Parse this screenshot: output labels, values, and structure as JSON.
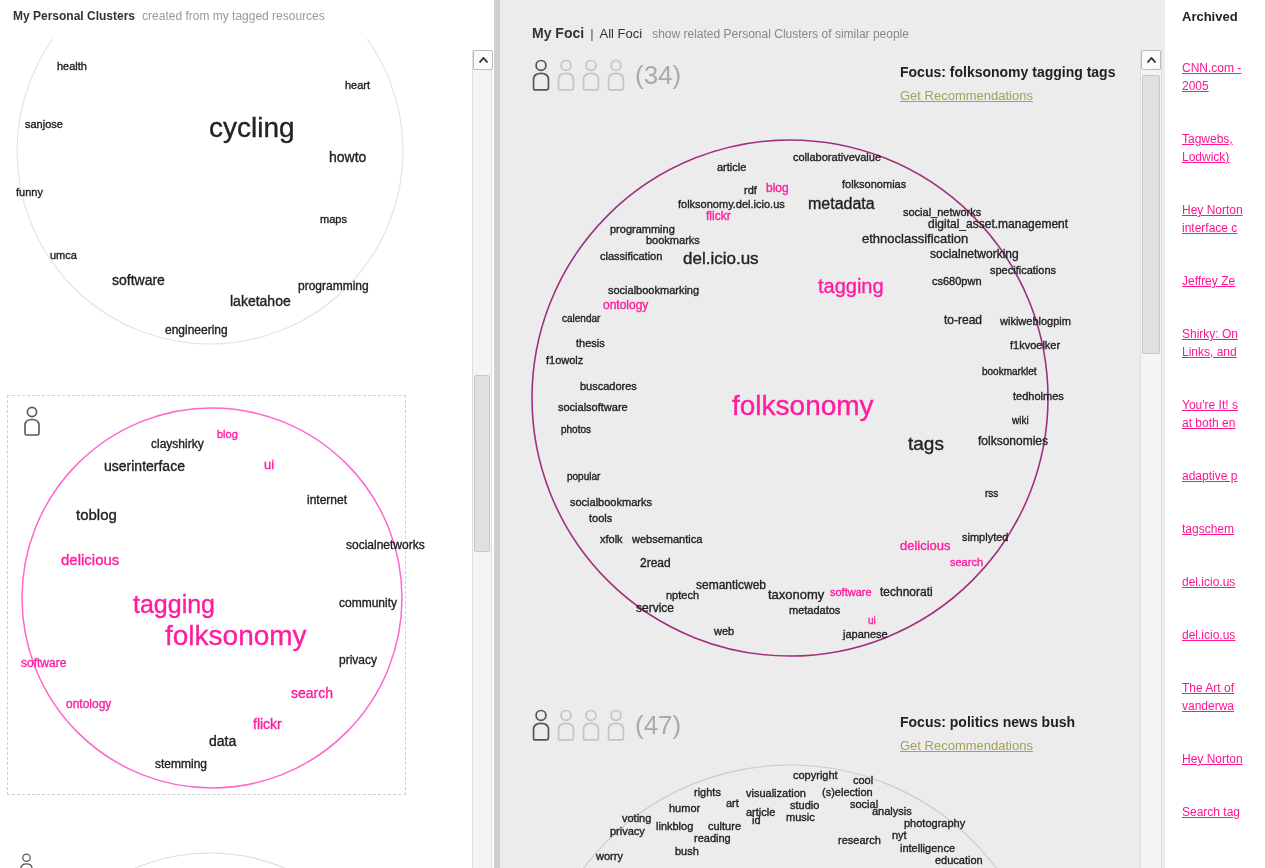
{
  "personal_clusters": {
    "title": "My Personal Clusters",
    "subtitle": "created from my tagged resources",
    "clusters": [
      {
        "color": "#e4e4e4",
        "tags": [
          {
            "text": "health",
            "color": "#222222"
          },
          {
            "text": "heart",
            "color": "#222222"
          },
          {
            "text": "sanjose",
            "color": "#222222"
          },
          {
            "text": "cycling",
            "color": "#222222"
          },
          {
            "text": "howto",
            "color": "#222222"
          },
          {
            "text": "funny",
            "color": "#222222"
          },
          {
            "text": "maps",
            "color": "#222222"
          },
          {
            "text": "umca",
            "color": "#222222"
          },
          {
            "text": "software",
            "color": "#222222"
          },
          {
            "text": "programming",
            "color": "#222222"
          },
          {
            "text": "laketahoe",
            "color": "#222222"
          },
          {
            "text": "engineering",
            "color": "#222222"
          }
        ]
      },
      {
        "color": "#ff66cc",
        "people": [
          {
            "active": true
          }
        ],
        "tags": [
          {
            "text": "clayshirky",
            "color": "#222222"
          },
          {
            "text": "blog",
            "color": "#ff1ca0"
          },
          {
            "text": "userinterface",
            "color": "#222222"
          },
          {
            "text": "ui",
            "color": "#ff1ca0"
          },
          {
            "text": "internet",
            "color": "#222222"
          },
          {
            "text": "toblog",
            "color": "#222222"
          },
          {
            "text": "socialnetworks",
            "color": "#222222"
          },
          {
            "text": "delicious",
            "color": "#ff1ca0"
          },
          {
            "text": "tagging",
            "color": "#ff1ca0"
          },
          {
            "text": "community",
            "color": "#222222"
          },
          {
            "text": "folksonomy",
            "color": "#ff1ca0"
          },
          {
            "text": "privacy",
            "color": "#222222"
          },
          {
            "text": "software",
            "color": "#ff1ca0"
          },
          {
            "text": "search",
            "color": "#ff1ca0"
          },
          {
            "text": "ontology",
            "color": "#ff1ca0"
          },
          {
            "text": "flickr",
            "color": "#ff1ca0"
          },
          {
            "text": "data",
            "color": "#222222"
          },
          {
            "text": "stemming",
            "color": "#222222"
          }
        ]
      },
      {
        "color": "#dddddd",
        "people": [
          {
            "active": true
          }
        ]
      }
    ]
  },
  "foci": {
    "title": "My Foci",
    "separator": "|",
    "all_link": "All Foci",
    "hint": "show related Personal Clusters of similar people",
    "clusters": [
      {
        "people": [
          {
            "active": true
          },
          {
            "active": false
          },
          {
            "active": false
          },
          {
            "active": false
          }
        ],
        "count": "(34)",
        "focus": "Focus: folksonomy tagging tags",
        "link": "Get Recommendations",
        "color": "#a0307f",
        "tags": [
          {
            "text": "collaborativevalue",
            "color": "#222222"
          },
          {
            "text": "article",
            "color": "#222222"
          },
          {
            "text": "rdf",
            "color": "#222222"
          },
          {
            "text": "blog",
            "color": "#ff1ca0"
          },
          {
            "text": "folksonomias",
            "color": "#222222"
          },
          {
            "text": "folksonomy.del.icio.us",
            "color": "#222222"
          },
          {
            "text": "metadata",
            "color": "#222222"
          },
          {
            "text": "flickr",
            "color": "#ff1ca0"
          },
          {
            "text": "social_networks",
            "color": "#222222"
          },
          {
            "text": "digital_asset.management",
            "color": "#222222"
          },
          {
            "text": "programming",
            "color": "#222222"
          },
          {
            "text": "bookmarks",
            "color": "#222222"
          },
          {
            "text": "ethnoclassification",
            "color": "#222222"
          },
          {
            "text": "classification",
            "color": "#222222"
          },
          {
            "text": "del.icio.us",
            "color": "#222222"
          },
          {
            "text": "socialnetworking",
            "color": "#222222"
          },
          {
            "text": "specifications",
            "color": "#222222"
          },
          {
            "text": "cs680pwn",
            "color": "#222222"
          },
          {
            "text": "socialbookmarking",
            "color": "#222222"
          },
          {
            "text": "tagging",
            "color": "#ff1ca0"
          },
          {
            "text": "ontology",
            "color": "#ff1ca0"
          },
          {
            "text": "calendar",
            "color": "#222222"
          },
          {
            "text": "to-read",
            "color": "#222222"
          },
          {
            "text": "wikiweblogpim",
            "color": "#222222"
          },
          {
            "text": "thesis",
            "color": "#222222"
          },
          {
            "text": "f1kvoelker",
            "color": "#222222"
          },
          {
            "text": "f1owolz",
            "color": "#222222"
          },
          {
            "text": "bookmarklet",
            "color": "#222222"
          },
          {
            "text": "buscadores",
            "color": "#222222"
          },
          {
            "text": "folksonomy",
            "color": "#ff1ca0"
          },
          {
            "text": "tedholmes",
            "color": "#222222"
          },
          {
            "text": "socialsoftware",
            "color": "#222222"
          },
          {
            "text": "wiki",
            "color": "#222222"
          },
          {
            "text": "photos",
            "color": "#222222"
          },
          {
            "text": "tags",
            "color": "#222222"
          },
          {
            "text": "folksonomies",
            "color": "#222222"
          },
          {
            "text": "popular",
            "color": "#222222"
          },
          {
            "text": "rss",
            "color": "#222222"
          },
          {
            "text": "socialbookmarks",
            "color": "#222222"
          },
          {
            "text": "tools",
            "color": "#222222"
          },
          {
            "text": "xfolk",
            "color": "#222222"
          },
          {
            "text": "websemantica",
            "color": "#222222"
          },
          {
            "text": "simplyted",
            "color": "#222222"
          },
          {
            "text": "delicious",
            "color": "#ff1ca0"
          },
          {
            "text": "search",
            "color": "#ff1ca0"
          },
          {
            "text": "2read",
            "color": "#222222"
          },
          {
            "text": "semanticweb",
            "color": "#222222"
          },
          {
            "text": "nptech",
            "color": "#222222"
          },
          {
            "text": "taxonomy",
            "color": "#222222"
          },
          {
            "text": "software",
            "color": "#ff1ca0"
          },
          {
            "text": "technorati",
            "color": "#222222"
          },
          {
            "text": "service",
            "color": "#222222"
          },
          {
            "text": "metadatos",
            "color": "#222222"
          },
          {
            "text": "ui",
            "color": "#ff1ca0"
          },
          {
            "text": "web",
            "color": "#222222"
          },
          {
            "text": "japanese",
            "color": "#222222"
          }
        ]
      },
      {
        "people": [
          {
            "active": true
          },
          {
            "active": false
          },
          {
            "active": false
          },
          {
            "active": false
          }
        ],
        "count": "(47)",
        "focus": "Focus: politics news bush",
        "link": "Get Recommendations",
        "color": "#cccccc",
        "tags": [
          {
            "text": "copyright",
            "color": "#222222"
          },
          {
            "text": "cool",
            "color": "#222222"
          },
          {
            "text": "rights",
            "color": "#222222"
          },
          {
            "text": "visualization",
            "color": "#222222"
          },
          {
            "text": "(s)election",
            "color": "#222222"
          },
          {
            "text": "art",
            "color": "#222222"
          },
          {
            "text": "studio",
            "color": "#222222"
          },
          {
            "text": "social",
            "color": "#222222"
          },
          {
            "text": "humor",
            "color": "#222222"
          },
          {
            "text": "article",
            "color": "#222222"
          },
          {
            "text": "music",
            "color": "#222222"
          },
          {
            "text": "analysis",
            "color": "#222222"
          },
          {
            "text": "photography",
            "color": "#222222"
          },
          {
            "text": "nyt",
            "color": "#222222"
          },
          {
            "text": "voting",
            "color": "#222222"
          },
          {
            "text": "linkblog",
            "color": "#222222"
          },
          {
            "text": "privacy",
            "color": "#222222"
          },
          {
            "text": "id",
            "color": "#222222"
          },
          {
            "text": "culture",
            "color": "#222222"
          },
          {
            "text": "reading",
            "color": "#222222"
          },
          {
            "text": "research",
            "color": "#222222"
          },
          {
            "text": "bush",
            "color": "#222222"
          },
          {
            "text": "intelligence",
            "color": "#222222"
          },
          {
            "text": "education",
            "color": "#222222"
          },
          {
            "text": "worry",
            "color": "#222222"
          }
        ]
      }
    ]
  },
  "archived": {
    "title": "Archived",
    "links": [
      "CNN.com -\n2005",
      "Tagwebs,\nLodwick)",
      "Hey Norton\ninterface c",
      "Jeffrey Ze",
      "Shirky: On\nLinks, and",
      "You're It! s\nat both en",
      "adaptive p",
      "tagschem",
      "del.icio.us",
      "del.icio.us",
      "The Art of\nvanderwa",
      "Hey Norton",
      "Search tag"
    ]
  }
}
